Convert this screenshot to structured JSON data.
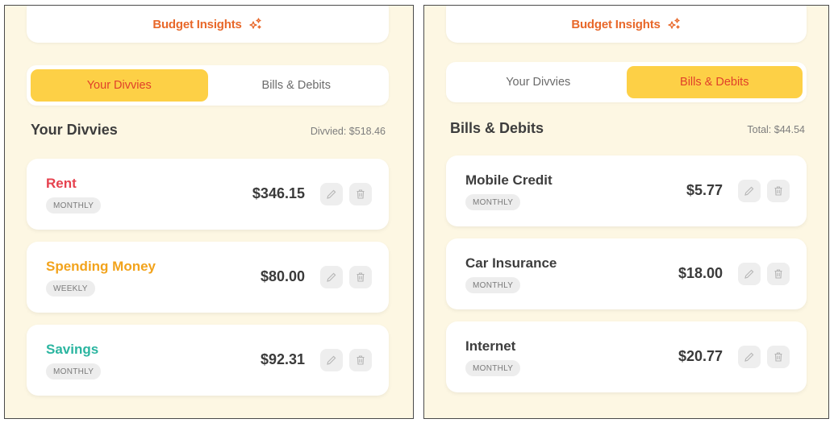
{
  "colors": {
    "accent_orange": "#e8682a",
    "tab_active_bg": "#fdd046",
    "tab_active_text": "#e0402a",
    "background": "#fdf7e3",
    "rent": "#e6424f",
    "spending": "#f2a31c",
    "savings": "#2bb5a0",
    "neutral_name": "#3d3d3d"
  },
  "panels": [
    {
      "insights_label": "Budget Insights",
      "tabs": [
        "Your Divvies",
        "Bills & Debits"
      ],
      "active_tab": 0,
      "section_title": "Your Divvies",
      "section_total": "Divvied: $518.46",
      "items": [
        {
          "name": "Rent",
          "frequency": "MONTHLY",
          "amount": "$346.15",
          "color": "#e6424f"
        },
        {
          "name": "Spending Money",
          "frequency": "WEEKLY",
          "amount": "$80.00",
          "color": "#f2a31c"
        },
        {
          "name": "Savings",
          "frequency": "MONTHLY",
          "amount": "$92.31",
          "color": "#2bb5a0"
        }
      ]
    },
    {
      "insights_label": "Budget Insights",
      "tabs": [
        "Your Divvies",
        "Bills & Debits"
      ],
      "active_tab": 1,
      "section_title": "Bills & Debits",
      "section_total": "Total: $44.54",
      "items": [
        {
          "name": "Mobile Credit",
          "frequency": "MONTHLY",
          "amount": "$5.77",
          "color": "#3d3d3d"
        },
        {
          "name": "Car Insurance",
          "frequency": "MONTHLY",
          "amount": "$18.00",
          "color": "#3d3d3d"
        },
        {
          "name": "Internet",
          "frequency": "MONTHLY",
          "amount": "$20.77",
          "color": "#3d3d3d"
        }
      ]
    }
  ],
  "icons": {
    "insights": "sparkle-icon",
    "edit": "pencil-icon",
    "delete": "trash-icon"
  }
}
